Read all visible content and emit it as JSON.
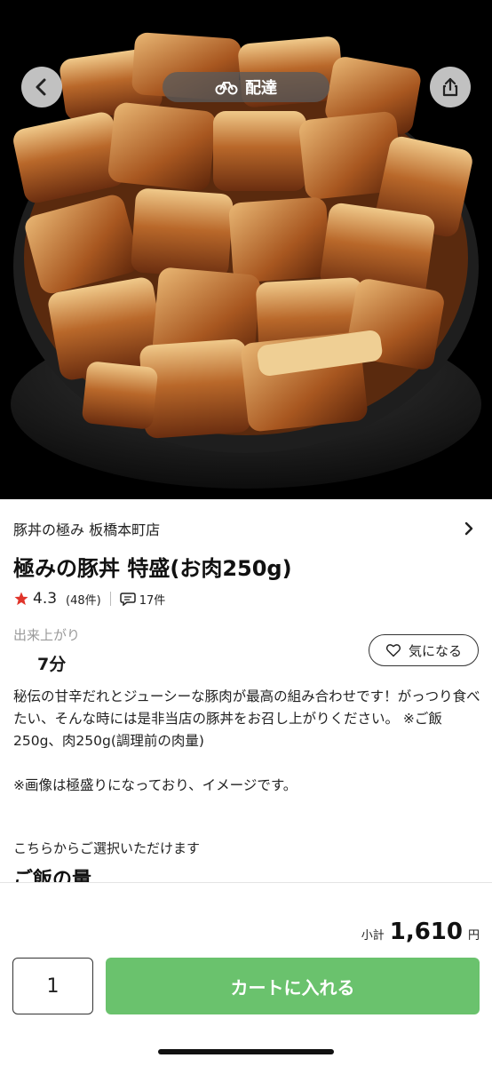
{
  "header": {
    "delivery_label": "配達",
    "icons": {
      "back": "chevron-left-icon",
      "share": "share-icon",
      "delivery": "bicycle-icon"
    }
  },
  "hero_image": {
    "subject": "butadon-bowl-photo"
  },
  "shop": {
    "name": "豚丼の極み 板橋本町店"
  },
  "item": {
    "title": "極みの豚丼 特盛(お肉250g)",
    "rating": "4.3",
    "rating_count": "(48件)",
    "review_count": "17件",
    "ready_label": "出来上がり",
    "ready_time": "7分",
    "favorite_label": "気になる",
    "description_1": "秘伝の甘辛だれとジューシーな豚肉が最高の組み合わせです！がっつり食べたい、そんな時には是非当店の豚丼をお召し上がりください。 ※ご飯250g、肉250g(調理前の肉量)",
    "description_2": "※画像は極盛りになっており、イメージです。",
    "choose_label": "こちらからご選択いただけます",
    "next_section_title": "ご飯の量"
  },
  "footer": {
    "subtotal_label": "小計",
    "subtotal_value": "1,610",
    "subtotal_unit": "円",
    "quantity": "1",
    "add_to_cart": "カートに入れる"
  },
  "colors": {
    "accent_green": "#6ac26d",
    "star_red": "#e0342a",
    "muted_gray": "#9a9a9a"
  }
}
